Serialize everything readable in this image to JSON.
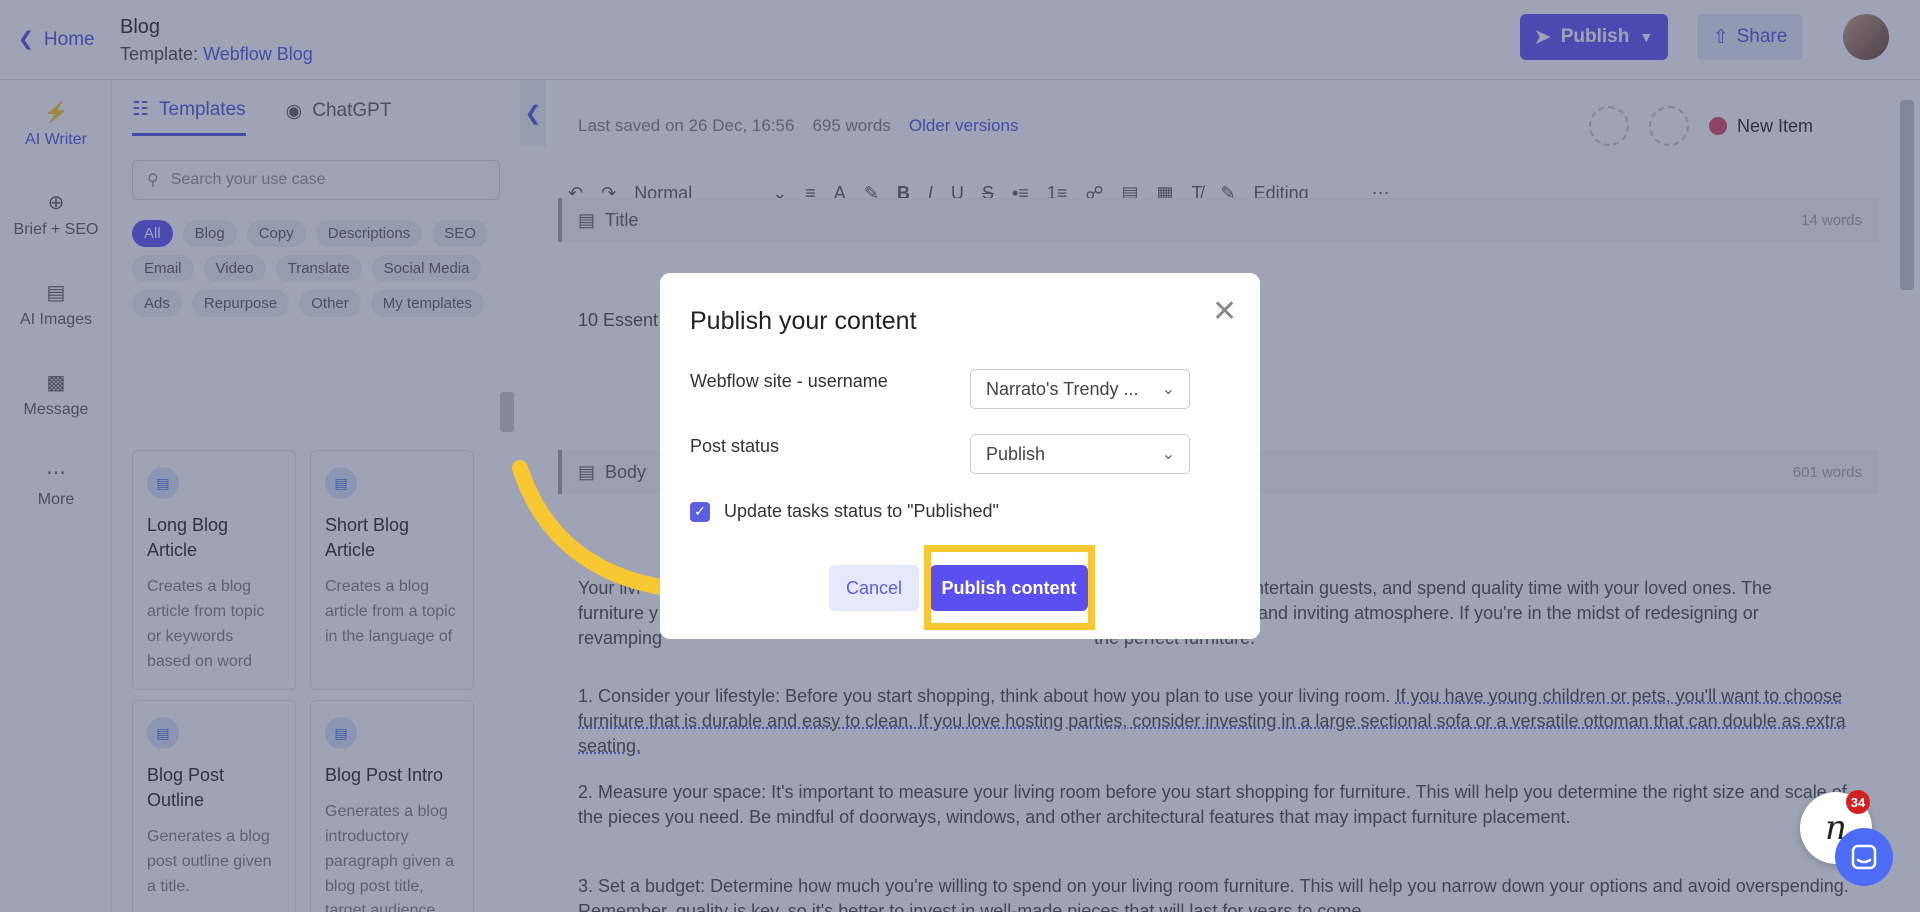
{
  "header": {
    "home_label": "Home",
    "doc_title": "Blog",
    "template_prefix": "Template:",
    "template_name": "Webflow Blog",
    "publish_label": "Publish",
    "share_label": "Share"
  },
  "rail": [
    {
      "label": "AI Writer",
      "icon": "bolt-icon"
    },
    {
      "label": "Brief + SEO",
      "icon": "target-icon"
    },
    {
      "label": "AI Images",
      "icon": "image-icon"
    },
    {
      "label": "Message",
      "icon": "message-icon"
    },
    {
      "label": "More",
      "icon": "more-icon"
    }
  ],
  "panel": {
    "tabs": [
      "Templates",
      "ChatGPT"
    ],
    "search_placeholder": "Search your use case",
    "chips": [
      "All",
      "Blog",
      "Copy",
      "Descriptions",
      "SEO",
      "Email",
      "Video",
      "Translate",
      "Social Media",
      "Ads",
      "Repurpose",
      "Other",
      "My templates"
    ],
    "cards": [
      {
        "title": "Long Blog Article",
        "desc": "Creates a blog article from topic or keywords based on word"
      },
      {
        "title": "Short Blog Article",
        "desc": "Creates a blog article from a topic in the language of"
      },
      {
        "title": "Blog Post Outline",
        "desc": "Generates a blog post outline given a title."
      },
      {
        "title": "Blog Post Intro",
        "desc": "Generates a blog introductory paragraph given a blog post title, target audience"
      }
    ]
  },
  "editor": {
    "last_saved": "Last saved on 26 Dec, 16:56",
    "word_count": "695 words",
    "older_versions": "Older versions",
    "new_item": "New Item",
    "toolbar": {
      "style": "Normal",
      "mode": "Editing"
    },
    "title_section": {
      "label": "Title",
      "words": "14 words",
      "text": "10 Essent"
    },
    "body_section": {
      "label": "Body",
      "words": "601 words"
    },
    "paragraphs": [
      {
        "a": "Your livi",
        "b": "entertain guests, and spend quality time with your loved ones. The"
      },
      {
        "a": "furniture y",
        "b": "and inviting atmosphere. If you're in the midst of redesigning or"
      },
      {
        "a": "revamping",
        "b": "the perfect furniture."
      }
    ],
    "p1": "1. Consider your lifestyle: Before you start shopping, think about how you plan to use your living room.",
    "p1_ul": "If you have young children or pets, you'll want to choose furniture that is durable and easy to clean. If you love hosting parties, consider investing in a large sectional sofa or a versatile ottoman that can double as extra seating.",
    "p2": "2. Measure your space: It's important to measure your living room before you start shopping for furniture. This will help you determine the right size and scale of the pieces you need. Be mindful of doorways, windows, and other architectural features that may impact furniture placement.",
    "p3": "3. Set a budget: Determine how much you're willing to spend on your living room furniture. This will help you narrow down your options and avoid overspending. Remember, quality is key, so it's better to invest in well-made pieces that will last for years to come."
  },
  "modal": {
    "title": "Publish your content",
    "site_label": "Webflow site - username",
    "site_value": "Narrato's Trendy ...",
    "status_label": "Post status",
    "status_value": "Publish",
    "checkbox_label": "Update tasks status to \"Published\"",
    "checkbox_checked": true,
    "cancel_label": "Cancel",
    "publish_label": "Publish content"
  },
  "chat": {
    "badge": "34",
    "logo": "n"
  },
  "colors": {
    "accent": "#5b5fe0",
    "highlight": "#f8c832",
    "button": "#5b4ff0"
  }
}
